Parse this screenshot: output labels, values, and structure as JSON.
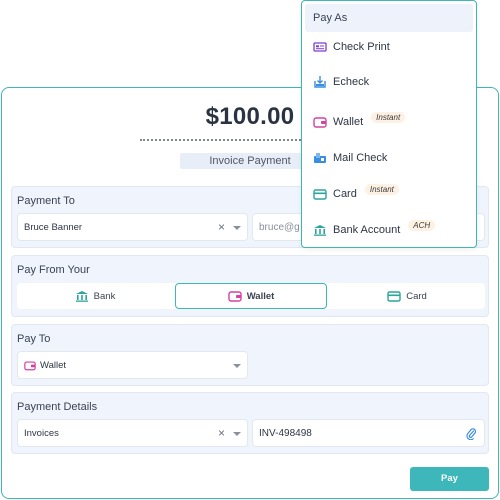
{
  "payment": {
    "amount": "$100.00",
    "description": "Invoice Payment"
  },
  "payment_to": {
    "title": "Payment To",
    "recipient": "Bruce Banner",
    "email_partial": "bruce@g"
  },
  "pay_from": {
    "title": "Pay From Your",
    "tabs": [
      {
        "label": "Bank",
        "icon": "bank-icon"
      },
      {
        "label": "Wallet",
        "icon": "wallet-icon"
      },
      {
        "label": "Card",
        "icon": "card-icon"
      }
    ],
    "selected": "Wallet"
  },
  "pay_to": {
    "title": "Pay To",
    "selected": "Wallet"
  },
  "payment_details": {
    "title": "Payment Details",
    "category": "Invoices",
    "invoice_number": "INV-498498"
  },
  "pay_button": "Pay",
  "pay_as_menu": {
    "header": "Pay As",
    "items": [
      {
        "label": "Check Print",
        "icon": "check-print-icon",
        "badge": ""
      },
      {
        "label": "Echeck",
        "icon": "echeck-icon",
        "badge": ""
      },
      {
        "label": "Wallet",
        "icon": "wallet-icon",
        "badge": "Instant"
      },
      {
        "label": "Mail Check",
        "icon": "mail-check-icon",
        "badge": ""
      },
      {
        "label": "Card",
        "icon": "card-icon",
        "badge": "Instant"
      },
      {
        "label": "Bank Account",
        "icon": "bank-icon",
        "badge": "ACH"
      }
    ]
  },
  "colors": {
    "accent": "#3db7b9",
    "section_bg": "#f0f4fc",
    "wallet_pink": "#d6409f",
    "check_purple": "#7b3fd1",
    "echeck_blue": "#3a8ee0",
    "bank_teal": "#2aa59b"
  }
}
